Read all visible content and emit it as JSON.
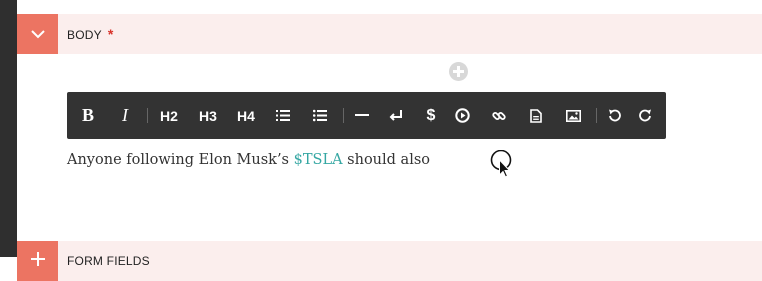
{
  "body_section": {
    "title": "BODY",
    "required_mark": "*",
    "toggle_icon": "chevron-down-icon",
    "accent_color": "#ec7462"
  },
  "editor": {
    "add_block_icon": "plus-circle-icon",
    "toolbar": {
      "bold": "B",
      "italic": "I",
      "h2": "H2",
      "h3": "H3",
      "h4": "H4",
      "ordered_list_icon": "ordered-list-icon",
      "bullet_list_icon": "bullet-list-icon",
      "horizontal_rule_icon": "horizontal-rule-icon",
      "line_break_icon": "line-break-icon",
      "dollar": "$",
      "media_icon": "play-circle-icon",
      "link_icon": "link-icon",
      "document_icon": "document-icon",
      "image_icon": "image-icon",
      "undo_icon": "undo-icon",
      "redo_icon": "redo-icon"
    },
    "content": {
      "before": "Anyone following Elon Musk’s ",
      "ticker": "$TSLA",
      "after": " should also"
    },
    "ticker_color": "#35a7a3"
  },
  "form_section": {
    "title": "FORM FIELDS",
    "toggle_icon": "plus-icon"
  }
}
